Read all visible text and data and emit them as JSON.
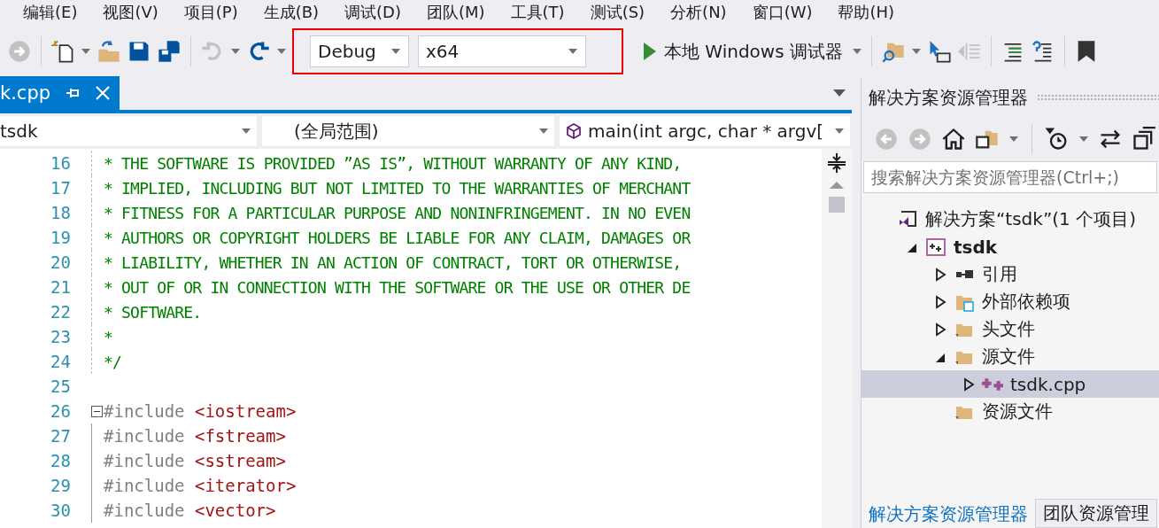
{
  "menu": [
    "编辑(E)",
    "视图(V)",
    "项目(P)",
    "生成(B)",
    "调试(D)",
    "团队(M)",
    "工具(T)",
    "测试(S)",
    "分析(N)",
    "窗口(W)",
    "帮助(H)"
  ],
  "toolbar": {
    "configuration": "Debug",
    "platform": "x64",
    "highlighted": true,
    "run_label": "本地 Windows 调试器"
  },
  "tabs": [
    {
      "label": "k.cpp",
      "selected": true
    }
  ],
  "navbar": {
    "project": "tsdk",
    "scope": "(全局范围)",
    "member": "main(int argc, char * argv["
  },
  "code_lines": [
    {
      "number": "16",
      "kind": "comment",
      "text": "* THE SOFTWARE IS PROVIDED ”AS IS”, WITHOUT WARRANTY OF ANY KIND,"
    },
    {
      "number": "17",
      "kind": "comment",
      "text": "* IMPLIED, INCLUDING BUT NOT LIMITED TO THE WARRANTIES OF MERCHANT"
    },
    {
      "number": "18",
      "kind": "comment",
      "text": "* FITNESS FOR A PARTICULAR PURPOSE AND NONINFRINGEMENT. IN NO EVEN"
    },
    {
      "number": "19",
      "kind": "comment",
      "text": "* AUTHORS OR COPYRIGHT HOLDERS BE LIABLE FOR ANY CLAIM, DAMAGES OR"
    },
    {
      "number": "20",
      "kind": "comment",
      "text": "* LIABILITY, WHETHER IN AN ACTION OF CONTRACT, TORT OR OTHERWISE,"
    },
    {
      "number": "21",
      "kind": "comment",
      "text": "* OUT OF OR IN CONNECTION WITH THE SOFTWARE OR THE USE OR OTHER DE"
    },
    {
      "number": "22",
      "kind": "comment",
      "text": "* SOFTWARE."
    },
    {
      "number": "23",
      "kind": "comment",
      "text": "*"
    },
    {
      "number": "24",
      "kind": "comment",
      "text": "*/"
    },
    {
      "number": "25",
      "kind": "blank"
    },
    {
      "number": "26",
      "kind": "include",
      "directive": "#include",
      "header": "<iostream>",
      "fold": true
    },
    {
      "number": "27",
      "kind": "include",
      "directive": "#include",
      "header": "<fstream>",
      "fold": false
    },
    {
      "number": "28",
      "kind": "include",
      "directive": "#include",
      "header": "<sstream>",
      "fold": false
    },
    {
      "number": "29",
      "kind": "include",
      "directive": "#include",
      "header": "<iterator>",
      "fold": false
    },
    {
      "number": "30",
      "kind": "include",
      "directive": "#include",
      "header": "<vector>",
      "fold": false
    }
  ],
  "explorer": {
    "title": "解决方案资源管理器",
    "search": {
      "placeholder": "搜索解决方案资源管理器(Ctrl+;)"
    },
    "tree": [
      {
        "label": "解决方案“tsdk”(1 个项目)",
        "kind": "solution",
        "selected": false,
        "children": [
          {
            "label": "tsdk",
            "kind": "project",
            "expanded": true,
            "selected": false,
            "children": [
              {
                "label": "引用",
                "kind": "references",
                "expanded": false,
                "selected": false
              },
              {
                "label": "外部依赖项",
                "kind": "external",
                "expanded": false,
                "selected": false
              },
              {
                "label": "头文件",
                "kind": "folder",
                "expanded": false,
                "selected": false
              },
              {
                "label": "源文件",
                "kind": "folder",
                "expanded": true,
                "selected": false,
                "children": [
                  {
                    "label": "tsdk.cpp",
                    "kind": "cpp",
                    "expanded": false,
                    "selected": true
                  }
                ]
              },
              {
                "label": "资源文件",
                "kind": "folder",
                "selected": false
              }
            ]
          }
        ]
      }
    ],
    "bottom_tabs": [
      {
        "label": "解决方案资源管理器",
        "selected": true
      },
      {
        "label": "团队资源管理",
        "selected": false
      }
    ]
  }
}
